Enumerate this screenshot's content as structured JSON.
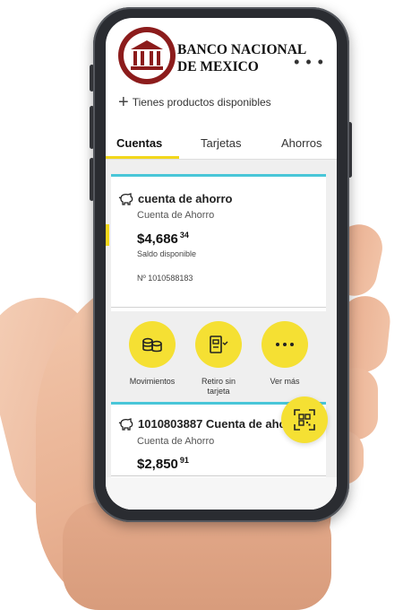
{
  "header": {
    "bank_name_line1": "BANCO NACIONAL",
    "bank_name_line2": "DE MEXICO",
    "menu_dots": "• • •",
    "products_label": "Tienes productos disponibles"
  },
  "tabs": [
    {
      "label": "Cuentas",
      "active": true
    },
    {
      "label": "Tarjetas",
      "active": false
    },
    {
      "label": "Ahorros",
      "active": false
    }
  ],
  "accounts": [
    {
      "title": "cuenta de ahorro",
      "subtitle": "Cuenta de Ahorro",
      "balance_main": "$4,686",
      "balance_cents": "34",
      "balance_label": "Saldo disponible",
      "number": "Nº  1010588183"
    },
    {
      "title": "1010803887 Cuenta de aho",
      "subtitle": "Cuenta de Ahorro",
      "balance_main": "$2,850",
      "balance_cents": "91"
    }
  ],
  "actions": [
    {
      "label": "Movimientos",
      "icon": "coins-icon"
    },
    {
      "label": "Retiro sin tarjeta",
      "icon": "atm-icon"
    },
    {
      "label": "Ver más",
      "icon": "more-icon"
    }
  ],
  "fab": {
    "icon": "qr-scan-icon"
  },
  "colors": {
    "accent_yellow": "#f5e033",
    "tab_underline": "#f2d71c",
    "card_top_border": "#49c6d8",
    "logo_red": "#8c1c1c"
  }
}
